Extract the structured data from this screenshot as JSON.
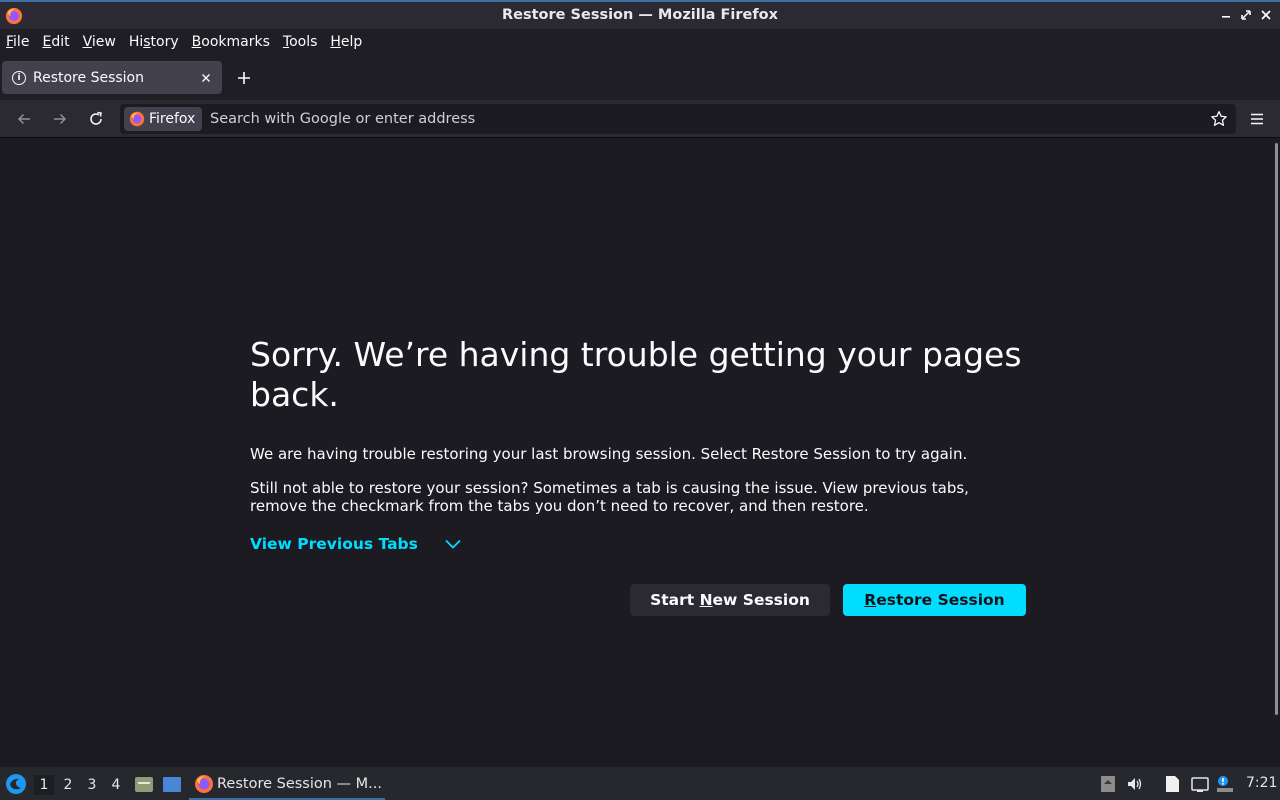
{
  "window": {
    "title": "Restore Session — Mozilla Firefox"
  },
  "menubar": {
    "items": [
      {
        "pre": "",
        "key": "F",
        "post": "ile"
      },
      {
        "pre": "",
        "key": "E",
        "post": "dit"
      },
      {
        "pre": "",
        "key": "V",
        "post": "iew"
      },
      {
        "pre": "Hi",
        "key": "s",
        "post": "tory"
      },
      {
        "pre": "",
        "key": "B",
        "post": "ookmarks"
      },
      {
        "pre": "",
        "key": "T",
        "post": "ools"
      },
      {
        "pre": "",
        "key": "H",
        "post": "elp"
      }
    ]
  },
  "tabs": [
    {
      "label": "Restore Session",
      "icon": "info-icon",
      "active": true
    }
  ],
  "navbar": {
    "identity_label": "Firefox",
    "url_placeholder": "Search with Google or enter address",
    "url_value": ""
  },
  "content": {
    "headline": "Sorry. We’re having trouble getting your pages back.",
    "para1": "We are having trouble restoring your last browsing session. Select Restore Session to try again.",
    "para2": "Still not able to restore your session? Sometimes a tab is causing the issue. View previous tabs, remove the checkmark from the tabs you don’t need to recover, and then restore.",
    "view_previous_tabs": "View Previous Tabs",
    "start_new_session": {
      "pre": "Start ",
      "key": "N",
      "post": "ew Session"
    },
    "restore_session": {
      "pre": "",
      "key": "R",
      "post": "estore Session"
    }
  },
  "taskbar": {
    "workspaces": [
      "1",
      "2",
      "3",
      "4"
    ],
    "active_workspace": "1",
    "task_label": "Restore Session — M...",
    "clock": "7:21"
  },
  "colors": {
    "accent": "#00ddff",
    "window_border": "#3d6fa6",
    "page_background": "#1c1b22"
  }
}
